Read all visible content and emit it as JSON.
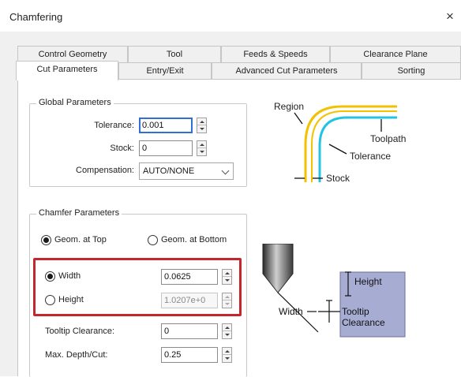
{
  "window": {
    "title": "Chamfering",
    "close_glyph": "×"
  },
  "tabs": {
    "row1": [
      "Control Geometry",
      "Tool",
      "Feeds & Speeds",
      "Clearance Plane"
    ],
    "row2": [
      "Cut Parameters",
      "Entry/Exit",
      "Advanced Cut Parameters",
      "Sorting"
    ],
    "active": "Cut Parameters"
  },
  "global": {
    "title": "Global Parameters",
    "tolerance_label": "Tolerance:",
    "tolerance_value": "0.001",
    "stock_label": "Stock:",
    "stock_value": "0",
    "compensation_label": "Compensation:",
    "compensation_value": "AUTO/NONE"
  },
  "region_diagram": {
    "region": "Region",
    "toolpath": "Toolpath",
    "tolerance": "Tolerance",
    "stock": "Stock",
    "colors": {
      "outer": "#f2c200",
      "inner": "#22c3e6",
      "line": "#111111"
    }
  },
  "chamfer": {
    "title": "Chamfer Parameters",
    "geom_top": "Geom. at Top",
    "geom_bottom": "Geom. at Bottom",
    "geom_selected": "top",
    "width_label": "Width",
    "width_value": "0.0625",
    "height_label": "Height",
    "height_value": "1.0207e+0",
    "mode_selected": "width",
    "tooltip_clearance_label": "Tooltip Clearance:",
    "tooltip_clearance_value": "0",
    "max_depth_label": "Max. Depth/Cut:",
    "max_depth_value": "0.25"
  },
  "chamfer_diagram": {
    "height": "Height",
    "width": "Width",
    "tooltip_line1": "Tooltip",
    "tooltip_line2": "Clearance",
    "colors": {
      "block": "#a7acd3",
      "tool_dark": "#2a2a2a",
      "tool_light": "#cfcfcf"
    }
  },
  "colors": {
    "highlight": "#c4262e",
    "focus": "#2f6fd6"
  },
  "icons": [
    "close-icon",
    "spin-up-icon",
    "spin-down-icon",
    "chevron-down-icon"
  ]
}
